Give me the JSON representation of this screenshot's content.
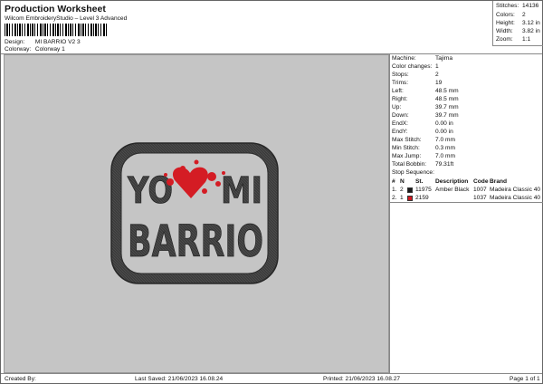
{
  "header": {
    "title": "Production Worksheet",
    "subtitle": "Wilcom EmbroideryStudio – Level 3 Advanced",
    "design_label": "Design:",
    "design_value": "MI BARRIO V2 3",
    "colorway_label": "Colorway:",
    "colorway_value": "Colorway 1"
  },
  "stats": [
    {
      "label": "Stitches:",
      "value": "14136"
    },
    {
      "label": "Colors:",
      "value": "2"
    },
    {
      "label": "Height:",
      "value": "3.12 in"
    },
    {
      "label": "Width:",
      "value": "3.82 in"
    },
    {
      "label": "Zoom:",
      "value": "1:1"
    }
  ],
  "info": [
    {
      "label": "Machine:",
      "value": "Tajima"
    },
    {
      "label": "Color changes:",
      "value": "1"
    },
    {
      "label": "Stops:",
      "value": "2"
    },
    {
      "label": "Trims:",
      "value": "19"
    },
    {
      "label": "Left:",
      "value": "48.5 mm"
    },
    {
      "label": "Right:",
      "value": "48.5 mm"
    },
    {
      "label": "Up:",
      "value": "39.7 mm"
    },
    {
      "label": "Down:",
      "value": "39.7 mm"
    },
    {
      "label": "EndX:",
      "value": "0.00 in"
    },
    {
      "label": "EndY:",
      "value": "0.00 in"
    },
    {
      "label": "Max Stitch:",
      "value": "7.0 mm"
    },
    {
      "label": "Min Stitch:",
      "value": "0.3 mm"
    },
    {
      "label": "Max Jump:",
      "value": "7.0 mm"
    },
    {
      "label": "Total Bobbin:",
      "value": "79.31ft"
    }
  ],
  "stop_sequence": {
    "title": "Stop Sequence:",
    "columns": {
      "num": "#",
      "n": "N",
      "st": "St.",
      "description": "Description",
      "code": "Code",
      "brand": "Brand"
    },
    "rows": [
      {
        "num": "1.",
        "n": "2",
        "st": "11975",
        "description": "Amber Black",
        "code": "1007",
        "brand": "Madeira Classic 40",
        "color": "#1a1a1a"
      },
      {
        "num": "2.",
        "n": "1",
        "st": "2159",
        "description": "",
        "code": "1037",
        "brand": "Madeira Classic 40",
        "color": "#d01820"
      }
    ]
  },
  "design": {
    "line1_left": "YO",
    "line1_right": "MI",
    "line2": "BARRIO",
    "thread_color": "#3a3a3a",
    "accent_color": "#d41c24"
  },
  "footer": {
    "created_by": "Created By:",
    "last_saved": "Last Saved: 21/06/2023 16.08.24",
    "printed": "Printed: 21/06/2023 16.08.27",
    "page": "Page 1 of 1"
  }
}
